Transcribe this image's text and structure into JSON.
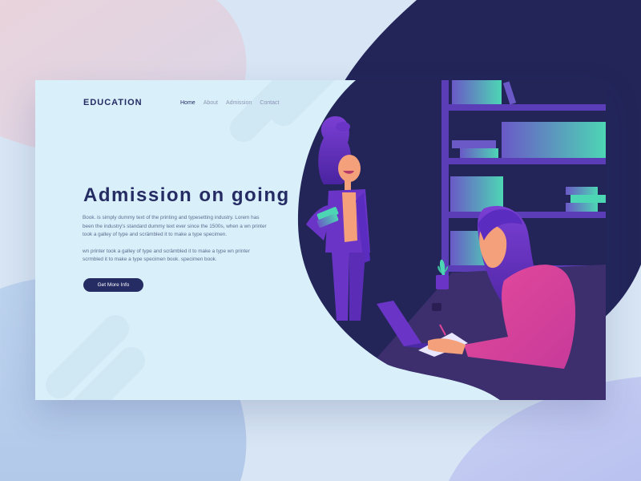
{
  "header": {
    "logo": "EDUCATION",
    "nav": [
      {
        "label": "Home",
        "active": true
      },
      {
        "label": "About",
        "active": false
      },
      {
        "label": "Admission",
        "active": false
      },
      {
        "label": "Contact",
        "active": false
      }
    ]
  },
  "hero": {
    "title": "Admission on going",
    "paragraphs": [
      "Book. is simply dummy text of the printing and typesetting industry. Lorem has been the industry's standard dummy text ever since the 1500s, when a wn printer took a galley of type and scrämbled it to make a type specimen.",
      "wn printer took a galley of type and scrämbled it to make a type wn printer scrmbled it to make a type specimen book. specimen book."
    ],
    "cta_label": "Get More Info"
  },
  "colors": {
    "navy": "#252b63",
    "card_bg": "#d9f0fa",
    "accent_purple": "#6a35c7",
    "accent_pink": "#e0459a",
    "accent_teal": "#4dd6b4"
  }
}
